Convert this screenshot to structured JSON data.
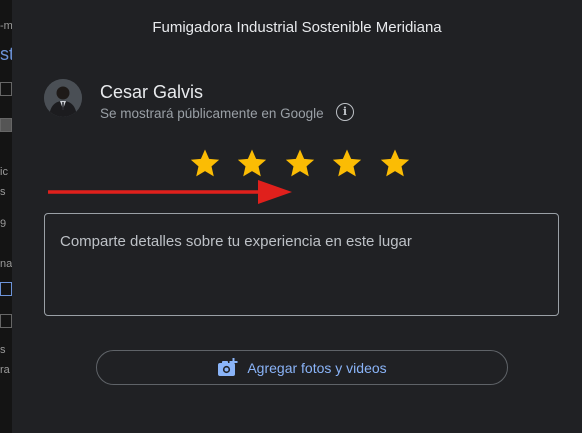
{
  "dialog": {
    "title": "Fumigadora Industrial Sostenible Meridiana"
  },
  "user": {
    "name": "Cesar Galvis",
    "subtitle": "Se mostrará públicamente en Google"
  },
  "rating": {
    "max": 5,
    "value": 5,
    "star_color": "#fbbc04"
  },
  "review_field": {
    "placeholder": "Comparte detalles sobre tu experiencia en este lugar"
  },
  "add_media": {
    "label": "Agregar fotos y videos",
    "icon": "add-photo-icon"
  },
  "annotation": {
    "arrow_color": "#e0201c"
  },
  "colors": {
    "modal_bg": "#202124",
    "accent": "#8ab4f8",
    "text_primary": "#e8eaed",
    "text_secondary": "#9aa0a6"
  }
}
